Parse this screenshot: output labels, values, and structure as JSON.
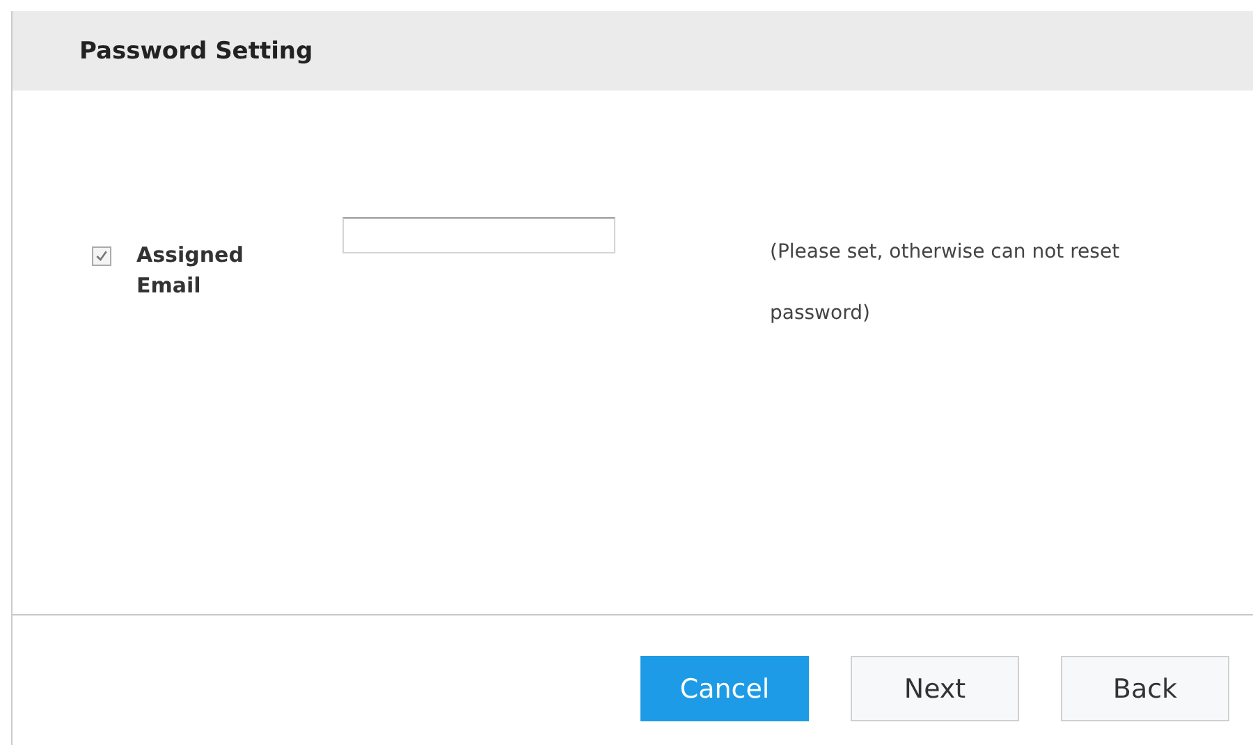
{
  "header": {
    "title": "Password Setting"
  },
  "email_row": {
    "label": "Assigned Email",
    "checked": true,
    "hint": "(Please set, otherwise can not reset password)"
  },
  "buttons": [
    {
      "label": "Cancel",
      "kind": "primary"
    },
    {
      "label": "Next",
      "kind": "default"
    },
    {
      "label": "Back",
      "kind": "default"
    }
  ]
}
